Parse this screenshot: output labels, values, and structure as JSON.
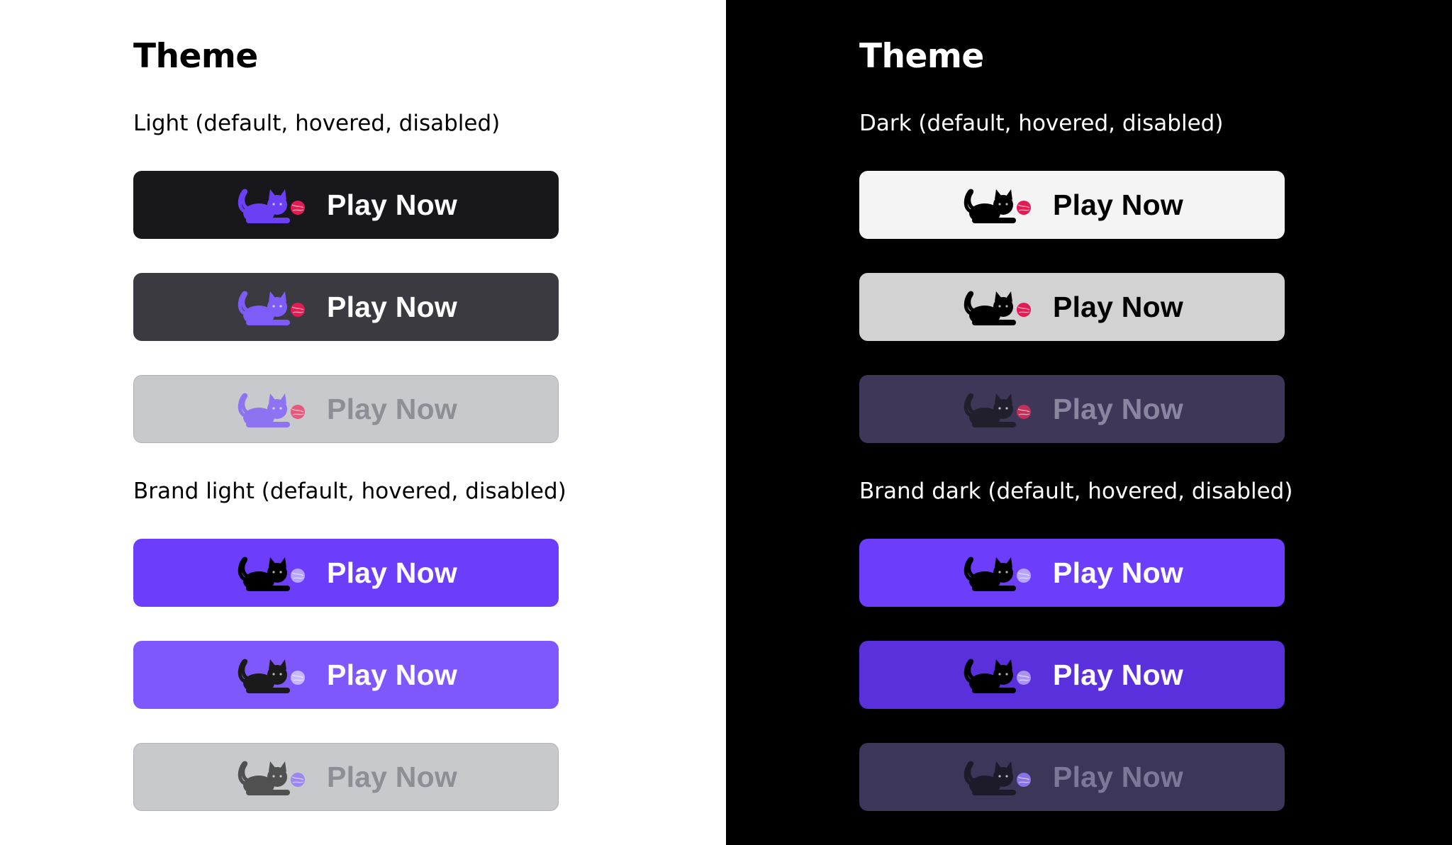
{
  "light": {
    "title": "Theme",
    "groups": [
      {
        "label": "Light (default, hovered, disabled)",
        "buttons": [
          {
            "state": "default",
            "label": "Play Now",
            "bg": "#18171c",
            "text": "#ffffff",
            "cat": "#6b40f5",
            "ball": "#e31b54"
          },
          {
            "state": "hovered",
            "label": "Play Now",
            "bg": "#3b3a40",
            "text": "#ffffff",
            "cat": "#7d5cf7",
            "ball": "#e31b54"
          },
          {
            "state": "disabled",
            "label": "Play Now",
            "bg": "#c8c9cd",
            "text": "#8e8f96",
            "cat": "#8d73f2",
            "ball": "#e8587b"
          }
        ]
      },
      {
        "label": "Brand light (default, hovered, disabled)",
        "buttons": [
          {
            "state": "default",
            "label": "Play Now",
            "bg": "#6c3dfb",
            "text": "#ffffff",
            "cat": "#000000",
            "ball": "#b7a4fb"
          },
          {
            "state": "hovered",
            "label": "Play Now",
            "bg": "#7f58fd",
            "text": "#ffffff",
            "cat": "#1a1a1a",
            "ball": "#c7b8fc"
          },
          {
            "state": "disabled",
            "label": "Play Now",
            "bg": "#c8c9cd",
            "text": "#8e8f96",
            "cat": "#505050",
            "ball": "#9c87f2"
          }
        ]
      }
    ]
  },
  "dark": {
    "title": "Theme",
    "groups": [
      {
        "label": "Dark (default, hovered, disabled)",
        "buttons": [
          {
            "state": "default",
            "label": "Play Now",
            "bg": "#f4f4f4",
            "text": "#000000",
            "cat": "#000000",
            "ball": "#e31b54"
          },
          {
            "state": "hovered",
            "label": "Play Now",
            "bg": "#d2d2d2",
            "text": "#000000",
            "cat": "#000000",
            "ball": "#e31b54"
          },
          {
            "state": "disabled",
            "label": "Play Now",
            "bg": "#3f3758",
            "text": "#8b86a0",
            "cat": "#221f2d",
            "ball": "#c2305a"
          }
        ]
      },
      {
        "label": "Brand dark (default, hovered, disabled)",
        "buttons": [
          {
            "state": "default",
            "label": "Play Now",
            "bg": "#6c3dfb",
            "text": "#ffffff",
            "cat": "#000000",
            "ball": "#b7a4fb"
          },
          {
            "state": "hovered",
            "label": "Play Now",
            "bg": "#5a30dc",
            "text": "#ffffff",
            "cat": "#000000",
            "ball": "#a994f5"
          },
          {
            "state": "disabled",
            "label": "Play Now",
            "bg": "#3c3659",
            "text": "#7e7898",
            "cat": "#1d1a2a",
            "ball": "#8a72e8"
          }
        ]
      }
    ]
  }
}
